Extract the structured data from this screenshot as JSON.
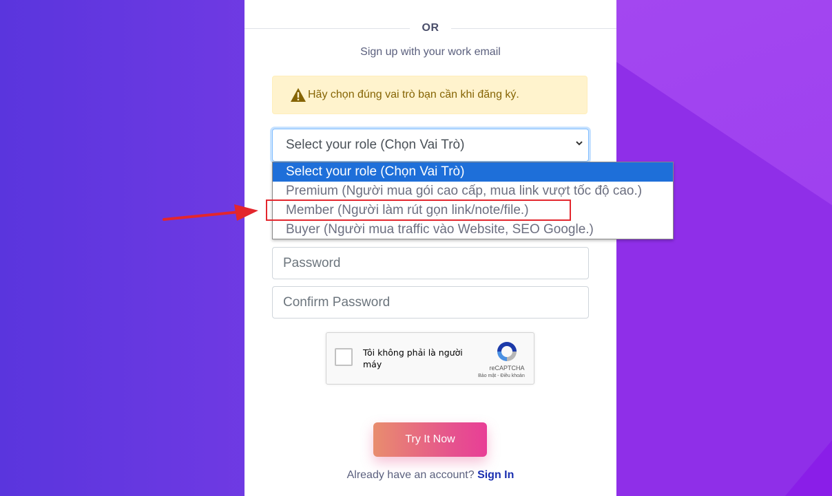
{
  "divider": {
    "or_text": "OR"
  },
  "signup": {
    "subtitle": "Sign up with your work email"
  },
  "alert": {
    "icon": "warning-icon",
    "text": "Hãy chọn đúng vai trò bạn cần khi đăng ký."
  },
  "role_select": {
    "value": "Select your role (Chọn Vai Trò)",
    "options": [
      "Select your role (Chọn Vai Trò)",
      "Premium (Người mua gói cao cấp, mua link vượt tốc độ cao.)",
      "Member (Người làm rút gọn link/note/file.)",
      "Buyer (Người mua traffic vào Website, SEO Google.)"
    ]
  },
  "fields": {
    "password_placeholder": "Password",
    "confirm_password_placeholder": "Confirm Password"
  },
  "recaptcha": {
    "label": "Tôi không phải là người máy",
    "brand": "reCAPTCHA",
    "links": "Bảo mật - Điều khoản"
  },
  "cta": {
    "label": "Try It Now"
  },
  "footer": {
    "prompt": "Already have an account?",
    "signin_label": "Sign In"
  },
  "colors": {
    "accent": "#1e6fd9",
    "highlight": "#e3262d",
    "link": "#1a2fb0",
    "alert_text": "#856404"
  }
}
